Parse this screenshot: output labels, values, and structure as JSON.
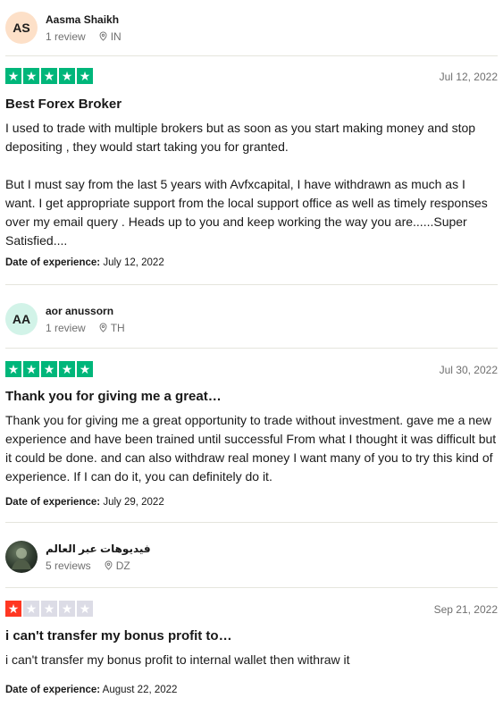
{
  "reviews": [
    {
      "initials": "AS",
      "avatar_color": "#fde0c8",
      "name": "Aasma Shaikh",
      "review_count": "1 review",
      "country": "IN",
      "rating": 5,
      "date": "Jul 12, 2022",
      "title": "Best Forex Broker",
      "paragraphs": [
        "I used to trade with multiple brokers but as soon as you start making money and stop depositing , they would start taking you for granted.",
        "But I must say from the last 5 years with Avfxcapital, I have withdrawn as much as I want. I get appropriate support from the local support office as well as timely responses over my email query . Heads up to you and keep working the way you are......Super Satisfied...."
      ],
      "experience_label": "Date of experience:",
      "experience_date": "July 12, 2022"
    },
    {
      "initials": "AA",
      "avatar_color": "#d2f3e8",
      "name": "aor anussorn",
      "review_count": "1 review",
      "country": "TH",
      "rating": 5,
      "date": "Jul 30, 2022",
      "title": "Thank you for giving me a great…",
      "paragraphs": [
        "Thank you for giving me a great opportunity to trade without investment. gave me a new experience and have been trained until successful From what I thought it was difficult but it could be done. and can also withdraw real money I want many of you to try this kind of experience. If I can do it, you can definitely do it."
      ],
      "experience_label": "Date of experience:",
      "experience_date": "July 29, 2022"
    },
    {
      "initials": "",
      "avatar_color": "#2e3a2e",
      "name": "فيديوهات عبر العالم",
      "review_count": "5 reviews",
      "country": "DZ",
      "rating": 1,
      "date": "Sep 21, 2022",
      "title": "i can't transfer my bonus profit to…",
      "paragraphs": [
        "i can't transfer my bonus profit to internal wallet then withraw it"
      ],
      "experience_label": "Date of experience:",
      "experience_date": "August 22, 2022"
    }
  ],
  "colors": {
    "star_green": "#00b67a",
    "star_red": "#ff3722",
    "star_empty": "#dcdce6"
  },
  "icons": [
    "location-pin-icon",
    "star-icon"
  ]
}
